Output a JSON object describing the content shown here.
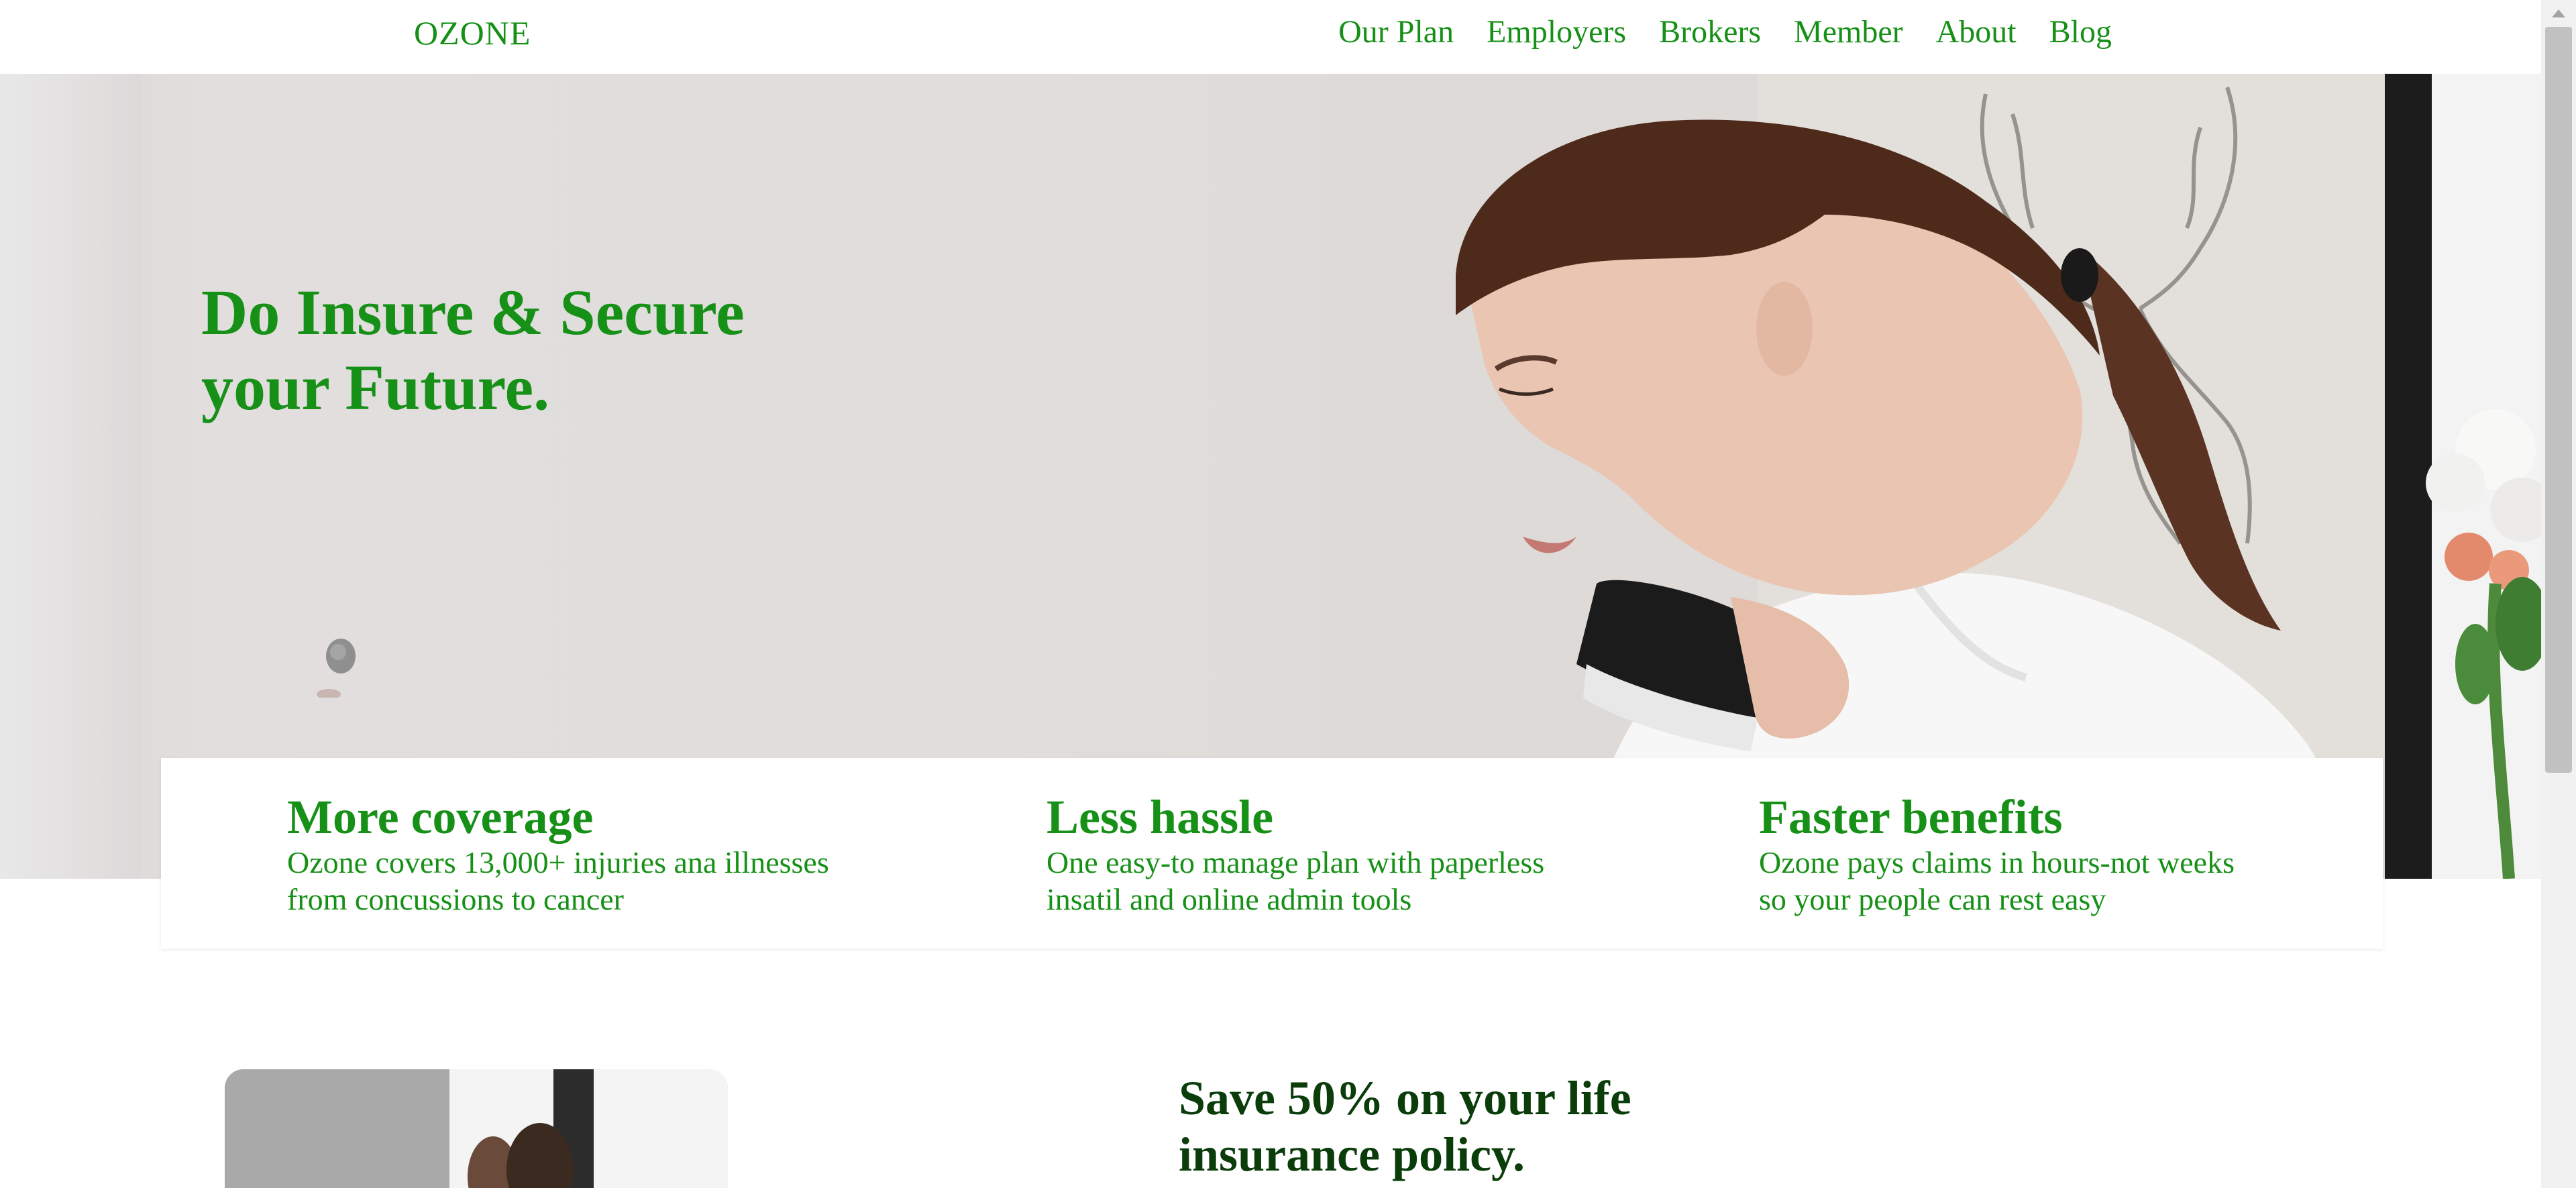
{
  "brand": {
    "logo": "OZONE"
  },
  "nav": {
    "items": [
      "Our Plan",
      "Employers",
      "Brokers",
      "Member",
      "About",
      "Blog"
    ]
  },
  "hero": {
    "title_line1": "Do Insure & Secure",
    "title_line2": "your Future."
  },
  "features": [
    {
      "title": "More coverage",
      "line1": "Ozone covers 13,000+ injuries ana illnesses",
      "line2": "from concussions to cancer"
    },
    {
      "title": "Less hassle",
      "line1": "One easy-to manage plan with paperless",
      "line2": "insatil and online admin tools"
    },
    {
      "title": "Faster benefits",
      "line1": "Ozone pays claims in hours-not weeks",
      "line2": "so your people can rest easy"
    }
  ],
  "promo": {
    "title_line1": "Save 50% on your life",
    "title_line2": "insurance policy."
  },
  "colors": {
    "brand_green": "#169016",
    "dark_green": "#0b3d0b"
  }
}
